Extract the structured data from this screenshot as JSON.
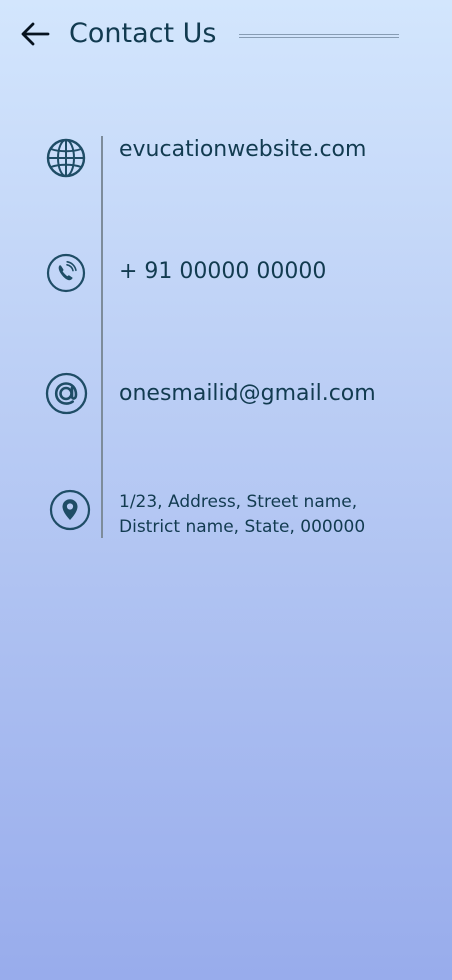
{
  "header": {
    "title": "Contact Us",
    "back_icon": "back-arrow-icon"
  },
  "contacts": [
    {
      "icon": "globe-icon",
      "value": "evucationwebsite.com"
    },
    {
      "icon": "phone-icon",
      "value": "+ 91 00000 00000"
    },
    {
      "icon": "at-icon",
      "value": "onesmailid@gmail.com"
    },
    {
      "icon": "location-pin-icon",
      "value": "1/23, Address, Street name, District name, State, 000000"
    }
  ],
  "colors": {
    "text": "#123b50",
    "divider": "#7d8c9b",
    "gradient_top": "#d3e6fd",
    "gradient_bottom": "#98acec"
  }
}
